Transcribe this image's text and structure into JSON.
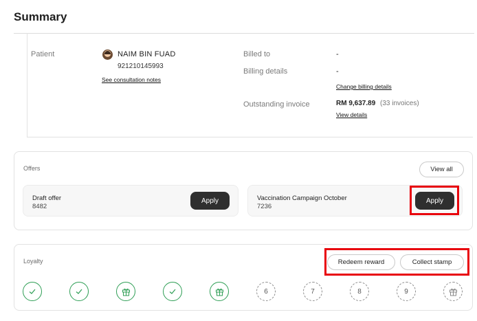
{
  "header": {
    "title": "Summary"
  },
  "patient": {
    "label": "Patient",
    "name": "NAIM BIN FUAD",
    "id": "921210145993",
    "consultation_link": "See consultation notes"
  },
  "billing": {
    "billed_to_label": "Billed to",
    "billed_to_value": "-",
    "details_label": "Billing details",
    "details_value": "-",
    "change_link": "Change billing details",
    "outstanding_label": "Outstanding invoice",
    "outstanding_amount": "RM 9,637.89",
    "outstanding_count": "(33 invoices)",
    "view_details_link": "View details"
  },
  "offers": {
    "title": "Offers",
    "view_all_label": "View all",
    "items": [
      {
        "name": "Draft offer",
        "code": "8482",
        "apply_label": "Apply"
      },
      {
        "name": "Vaccination Campaign October",
        "code": "7236",
        "apply_label": "Apply"
      }
    ]
  },
  "loyalty": {
    "title": "Loyalty",
    "redeem_label": "Redeem reward",
    "collect_label": "Collect stamp",
    "stamps": [
      {
        "state": "collected",
        "icon": "check-icon"
      },
      {
        "state": "collected",
        "icon": "check-icon"
      },
      {
        "state": "collected",
        "icon": "gift-icon"
      },
      {
        "state": "collected",
        "icon": "check-icon"
      },
      {
        "state": "collected",
        "icon": "gift-icon"
      },
      {
        "state": "pending",
        "label": "6"
      },
      {
        "state": "pending",
        "label": "7"
      },
      {
        "state": "pending",
        "label": "8"
      },
      {
        "state": "pending",
        "label": "9"
      },
      {
        "state": "pending",
        "icon": "gift-icon"
      }
    ]
  },
  "colors": {
    "accent_green": "#2e9e55",
    "highlight_red": "#e8000b",
    "button_dark": "#2f2f2f"
  }
}
